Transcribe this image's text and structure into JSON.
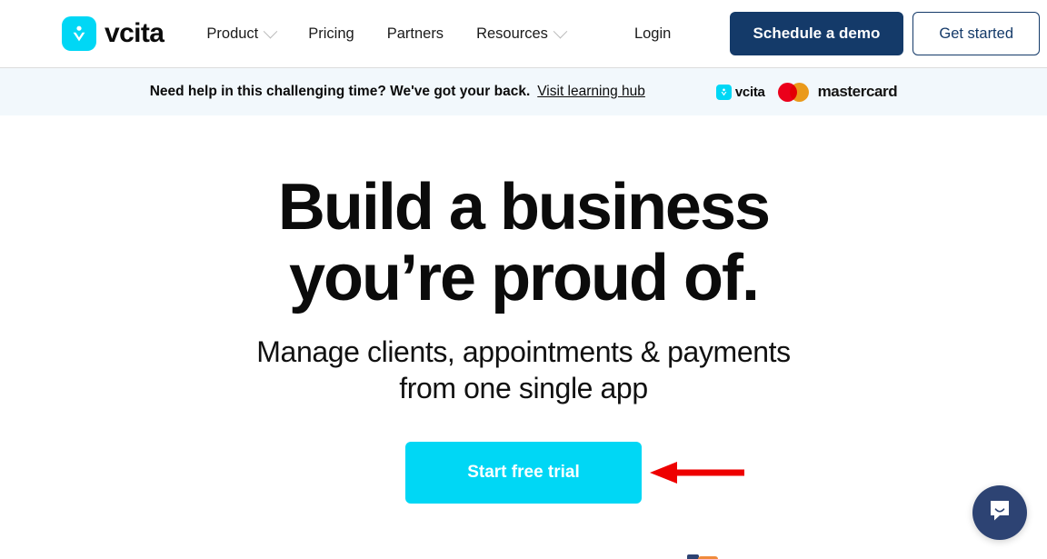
{
  "header": {
    "brand": {
      "icon": "vcita-logo-icon",
      "wordmark": "vcita"
    },
    "nav": [
      {
        "label": "Product",
        "has_chevron": true
      },
      {
        "label": "Pricing",
        "has_chevron": false
      },
      {
        "label": "Partners",
        "has_chevron": false
      },
      {
        "label": "Resources",
        "has_chevron": true
      }
    ],
    "login_label": "Login",
    "demo_button": "Schedule a demo",
    "get_started_button": "Get started",
    "demo_button_color": "#143A69",
    "get_started_border_color": "#143A69"
  },
  "banner": {
    "text": "Need help in this challenging time? We've got your back.",
    "link": "Visit learning hub",
    "background": "#F2F8FC",
    "partner_logos": [
      {
        "name": "vcita",
        "wordmark": "vcita"
      },
      {
        "name": "mastercard",
        "wordmark": "mastercard",
        "color_left": "#EB001B",
        "color_right": "#F79E1B"
      }
    ]
  },
  "hero": {
    "title_line1": "Build a business",
    "title_line2": "you’re proud of.",
    "subtitle_line1": "Manage clients, appointments & payments",
    "subtitle_line2": "from one single app",
    "cta_label": "Start free trial",
    "cta_color": "#00D7F5",
    "annotation": {
      "name": "red-arrow-pointing-to-cta",
      "color": "#EE0000",
      "direction": "left"
    }
  },
  "chat": {
    "icon": "chat-bubble-icon",
    "color": "#2D4373"
  }
}
